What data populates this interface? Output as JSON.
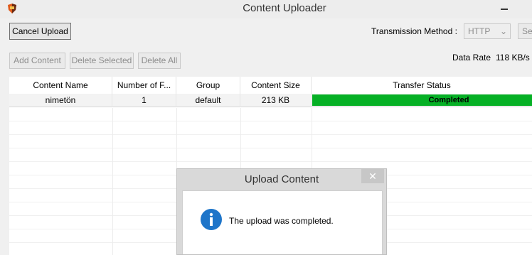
{
  "window": {
    "title": "Content Uploader"
  },
  "toolbar": {
    "cancel_upload": "Cancel Upload",
    "transmission_label": "Transmission Method :",
    "transmission_value": "HTTP",
    "settings_partial": "Set"
  },
  "actions": {
    "add_content": "Add Content",
    "delete_selected": "Delete Selected",
    "delete_all": "Delete All",
    "data_rate_label": "Data Rate",
    "data_rate_value": "118 KB/s"
  },
  "table": {
    "columns": [
      "Content Name",
      "Number of F...",
      "Group",
      "Content Size",
      "Transfer Status"
    ],
    "rows": [
      {
        "name": "nimetön",
        "files": "1",
        "group": "default",
        "size": "213 KB",
        "status": "Completed",
        "progress": 1.0
      }
    ]
  },
  "dialog": {
    "title": "Upload Content",
    "close_glyph": "✕",
    "message": "The upload was completed."
  },
  "colors": {
    "progress_fill": "#06b025",
    "info_icon": "#1e75c9"
  }
}
